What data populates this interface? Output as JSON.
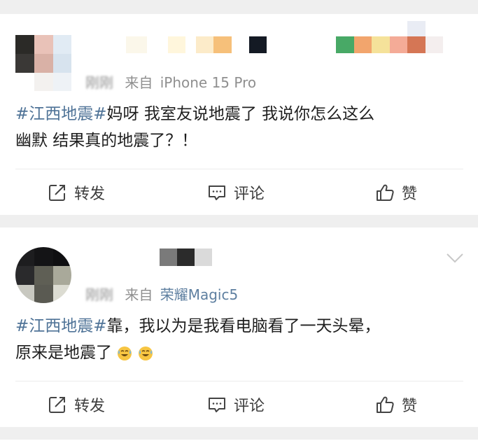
{
  "posts": [
    {
      "meta_time": "刚刚",
      "meta_from": "来自",
      "meta_source": "iPhone 15 Pro",
      "hashtag": "#江西地震#",
      "line1_rest": "妈呀 我室友说地震了 我说你怎么这么",
      "line2": "幽默 结果真的地震了？！",
      "actions": {
        "repost": "转发",
        "comment": "评论",
        "like": "赞"
      }
    },
    {
      "meta_time": "刚刚",
      "meta_from": "来自",
      "meta_source": "荣耀Magic5",
      "hashtag": "#江西地震#",
      "line1_rest": "靠，我以为是我看电脑看了一天头晕，",
      "line2": "原来是地震了",
      "emoji": [
        "sweat-smile-emoji",
        "sweat-smile-emoji"
      ],
      "actions": {
        "repost": "转发",
        "comment": "评论",
        "like": "赞"
      }
    }
  ],
  "colors": {
    "hashtag": "#4f7397",
    "source_brand": "#5e7fa0",
    "meta_gray": "#8f8f8f",
    "background": "#efefef"
  }
}
